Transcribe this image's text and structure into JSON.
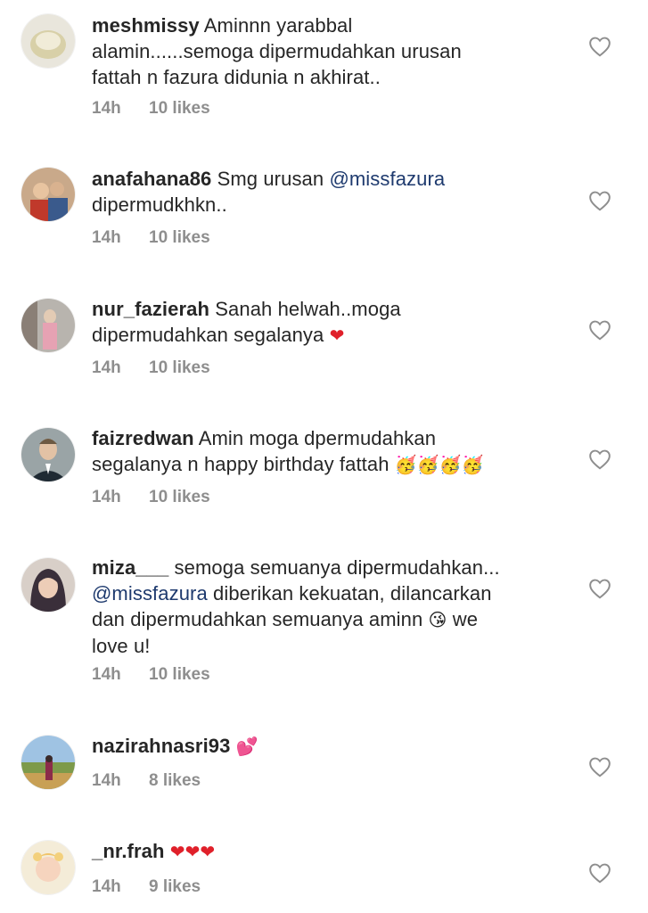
{
  "comments": [
    {
      "username": "meshmissy",
      "text_1": " Aminnn yarabbal",
      "text_2": "alamin......semoga dipermudahkan urusan",
      "text_3": "fattah n fazura didunia n akhirat..",
      "time": "14h",
      "likes": "10 likes"
    },
    {
      "username": "anafahana86",
      "text_pre": " Smg urusan ",
      "mention": "@missfazura",
      "text_2": "dipermudkhkn..",
      "time": "14h",
      "likes": "10 likes"
    },
    {
      "username": "nur_fazierah",
      "text_1": " Sanah helwah..moga",
      "text_2": "dipermudahkan segalanya ",
      "emoji": "❤",
      "time": "14h",
      "likes": "10 likes"
    },
    {
      "username": "faizredwan",
      "text_1": " Amin moga dpermudahkan",
      "text_2": "segalanya n happy birthday fattah ",
      "emoji": "🥳🥳🥳🥳",
      "time": "14h",
      "likes": "10 likes"
    },
    {
      "username": "miza___",
      "text_1": " semoga semuanya dipermudahkan...",
      "mention": "@missfazura",
      "text_2": " diberikan kekuatan, dilancarkan",
      "text_3": "dan dipermudahkan semuanya aminn ",
      "emoji": "😘",
      "text_3b": " we",
      "text_4": "love u!",
      "time": "14h",
      "likes": "10 likes"
    },
    {
      "username": "nazirahnasri93",
      "emoji": "💕",
      "time": "14h",
      "likes": "8 likes"
    },
    {
      "username": "_nr.frah",
      "emoji": "❤❤❤",
      "time": "14h",
      "likes": "9 likes"
    }
  ],
  "icons": {
    "like": "heart-outline-icon"
  },
  "colors": {
    "text": "#262626",
    "meta": "#8e8e8e",
    "mention": "#1e3a6e",
    "heart_emoji": "#e0202a"
  }
}
